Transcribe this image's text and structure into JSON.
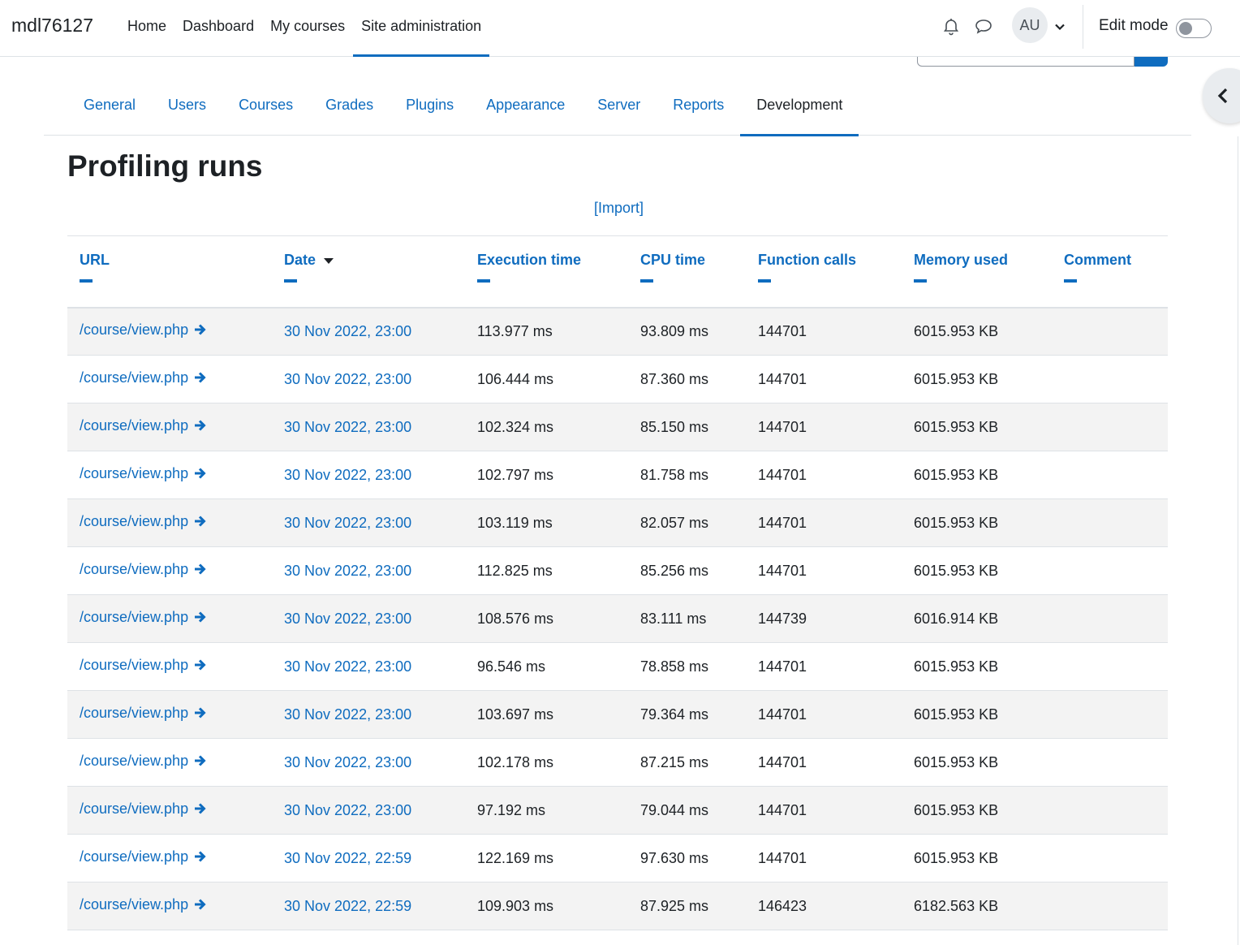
{
  "navbar": {
    "brand": "mdl76127",
    "items": [
      {
        "label": "Home"
      },
      {
        "label": "Dashboard"
      },
      {
        "label": "My courses"
      },
      {
        "label": "Site administration"
      }
    ],
    "avatar_initials": "AU",
    "edit_mode_label": "Edit mode"
  },
  "tabs": [
    {
      "label": "General"
    },
    {
      "label": "Users"
    },
    {
      "label": "Courses"
    },
    {
      "label": "Grades"
    },
    {
      "label": "Plugins"
    },
    {
      "label": "Appearance"
    },
    {
      "label": "Server"
    },
    {
      "label": "Reports"
    },
    {
      "label": "Development"
    }
  ],
  "page_title": "Profiling runs",
  "import_link": "[Import]",
  "table": {
    "columns": [
      "URL",
      "Date",
      "Execution time",
      "CPU time",
      "Function calls",
      "Memory used",
      "Comment"
    ],
    "sorted_column": "Date",
    "rows": [
      {
        "url": "/course/view.php",
        "date": "30 Nov 2022, 23:00",
        "exec": "113.977 ms",
        "cpu": "93.809 ms",
        "calls": "144701",
        "memory": "6015.953 KB",
        "comment": ""
      },
      {
        "url": "/course/view.php",
        "date": "30 Nov 2022, 23:00",
        "exec": "106.444 ms",
        "cpu": "87.360 ms",
        "calls": "144701",
        "memory": "6015.953 KB",
        "comment": ""
      },
      {
        "url": "/course/view.php",
        "date": "30 Nov 2022, 23:00",
        "exec": "102.324 ms",
        "cpu": "85.150 ms",
        "calls": "144701",
        "memory": "6015.953 KB",
        "comment": ""
      },
      {
        "url": "/course/view.php",
        "date": "30 Nov 2022, 23:00",
        "exec": "102.797 ms",
        "cpu": "81.758 ms",
        "calls": "144701",
        "memory": "6015.953 KB",
        "comment": ""
      },
      {
        "url": "/course/view.php",
        "date": "30 Nov 2022, 23:00",
        "exec": "103.119 ms",
        "cpu": "82.057 ms",
        "calls": "144701",
        "memory": "6015.953 KB",
        "comment": ""
      },
      {
        "url": "/course/view.php",
        "date": "30 Nov 2022, 23:00",
        "exec": "112.825 ms",
        "cpu": "85.256 ms",
        "calls": "144701",
        "memory": "6015.953 KB",
        "comment": ""
      },
      {
        "url": "/course/view.php",
        "date": "30 Nov 2022, 23:00",
        "exec": "108.576 ms",
        "cpu": "83.111 ms",
        "calls": "144739",
        "memory": "6016.914 KB",
        "comment": ""
      },
      {
        "url": "/course/view.php",
        "date": "30 Nov 2022, 23:00",
        "exec": "96.546 ms",
        "cpu": "78.858 ms",
        "calls": "144701",
        "memory": "6015.953 KB",
        "comment": ""
      },
      {
        "url": "/course/view.php",
        "date": "30 Nov 2022, 23:00",
        "exec": "103.697 ms",
        "cpu": "79.364 ms",
        "calls": "144701",
        "memory": "6015.953 KB",
        "comment": ""
      },
      {
        "url": "/course/view.php",
        "date": "30 Nov 2022, 23:00",
        "exec": "102.178 ms",
        "cpu": "87.215 ms",
        "calls": "144701",
        "memory": "6015.953 KB",
        "comment": ""
      },
      {
        "url": "/course/view.php",
        "date": "30 Nov 2022, 23:00",
        "exec": "97.192 ms",
        "cpu": "79.044 ms",
        "calls": "144701",
        "memory": "6015.953 KB",
        "comment": ""
      },
      {
        "url": "/course/view.php",
        "date": "30 Nov 2022, 22:59",
        "exec": "122.169 ms",
        "cpu": "97.630 ms",
        "calls": "144701",
        "memory": "6015.953 KB",
        "comment": ""
      },
      {
        "url": "/course/view.php",
        "date": "30 Nov 2022, 22:59",
        "exec": "109.903 ms",
        "cpu": "87.925 ms",
        "calls": "146423",
        "memory": "6182.563 KB",
        "comment": ""
      }
    ]
  }
}
